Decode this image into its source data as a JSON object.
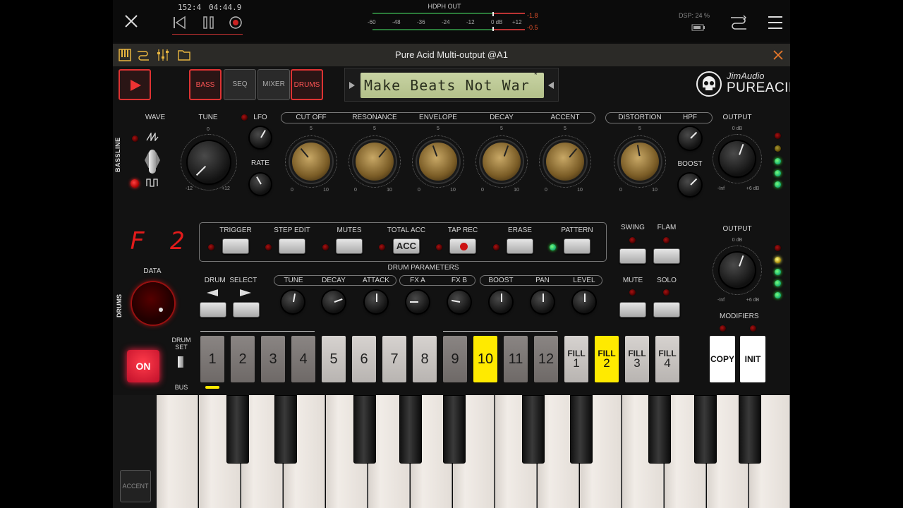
{
  "host": {
    "position": "152:4",
    "time": "04:44.9",
    "output_name": "HDPH OUT",
    "meter_ticks": [
      "-60",
      "-48",
      "-36",
      "-24",
      "-12",
      "0 dB",
      "+12"
    ],
    "peak_top": "-1.8",
    "peak_bottom": "-0.5",
    "dsp": "DSP: 24 %"
  },
  "plugin": {
    "title": "Pure Acid Multi-output @A1"
  },
  "modes": {
    "bass": "BASS",
    "seq": "SEQ",
    "mixer": "MIXER",
    "drums": "DRUMS"
  },
  "lcd": {
    "text": "Make Beats Not War",
    "star": "*"
  },
  "brand": {
    "top": "JimAudio",
    "bottom": "PUREACID"
  },
  "bass": {
    "section": "BASSLINE",
    "wave": "WAVE",
    "tune": "TUNE",
    "tune_zero": "0",
    "tune_min": "-12",
    "tune_max": "+12",
    "lfo": "LFO",
    "rate": "RATE",
    "knobs": [
      "CUT OFF",
      "RESONANCE",
      "ENVELOPE",
      "DECAY",
      "ACCENT"
    ],
    "dist": "DISTORTION",
    "hpf": "HPF",
    "boost": "BOOST",
    "output": "OUTPUT",
    "out_zero": "0 dB",
    "out_min": "-Inf",
    "out_max": "+6 dB",
    "scale_mid": "5",
    "scale_min": "0",
    "scale_max": "10"
  },
  "drums": {
    "section": "DRUMS",
    "display": "F 2",
    "data": "DATA",
    "toolbar": [
      "TRIGGER",
      "STEP EDIT",
      "MUTES",
      "TOTAL ACC",
      "TAP REC",
      "ERASE",
      "PATTERN"
    ],
    "acc_label": "ACC",
    "swing": "SWING",
    "flam": "FLAM",
    "mute": "MUTE",
    "solo": "SOLO",
    "output": "OUTPUT",
    "out_zero": "0 dB",
    "out_min": "-Inf",
    "out_max": "+6 dB",
    "params_title": "DRUM PARAMETERS",
    "drum_select": "DRUM  SELECT",
    "params": [
      "TUNE",
      "DECAY",
      "ATTACK",
      "FX A",
      "FX B",
      "BOOST",
      "PAN",
      "LEVEL"
    ],
    "modifiers": "MODIFIERS",
    "on": "ON",
    "drumset": "DRUM SET",
    "bus": "BUS",
    "steps": [
      "1",
      "2",
      "3",
      "4",
      "5",
      "6",
      "7",
      "8",
      "9",
      "10",
      "11",
      "12"
    ],
    "fill_word": "FILL",
    "fills": [
      "1",
      "2",
      "3",
      "4"
    ],
    "copy": "COPY",
    "init": "INIT"
  },
  "keyboard": {
    "accent": "ACCENT"
  }
}
